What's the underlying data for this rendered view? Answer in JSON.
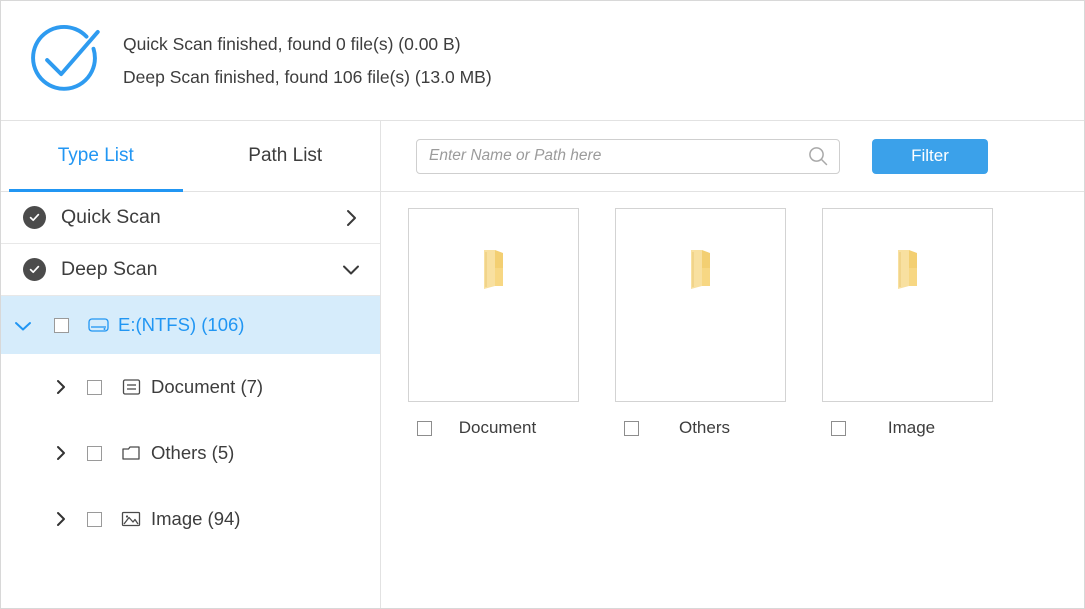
{
  "header": {
    "status_icon": "check-circle-icon",
    "lines": [
      "Quick Scan finished, found 0 file(s) (0.00  B)",
      "Deep Scan finished, found 106 file(s) (13.0 MB)"
    ]
  },
  "sidebar": {
    "tabs": [
      {
        "label": "Type List",
        "active": true
      },
      {
        "label": "Path List",
        "active": false
      }
    ],
    "scans": [
      {
        "label": "Quick Scan",
        "state_icon": "check-filled-icon",
        "chevron": "chevron-right-icon"
      },
      {
        "label": "Deep Scan",
        "state_icon": "check-filled-icon",
        "chevron": "chevron-down-icon"
      }
    ],
    "tree": [
      {
        "label": "E:(NTFS) (106)",
        "icon": "drive-icon",
        "chevron": "chevron-down-icon",
        "selected": true,
        "checked": false
      },
      {
        "label": "Document (7)",
        "icon": "document-icon",
        "chevron": "chevron-right-icon",
        "selected": false,
        "checked": false
      },
      {
        "label": "Others (5)",
        "icon": "folder-icon",
        "chevron": "chevron-right-icon",
        "selected": false,
        "checked": false
      },
      {
        "label": "Image (94)",
        "icon": "image-icon",
        "chevron": "chevron-right-icon",
        "selected": false,
        "checked": false
      }
    ]
  },
  "content": {
    "search": {
      "value": "",
      "placeholder": "Enter Name or Path here",
      "icon": "search-icon"
    },
    "filter_button": "Filter",
    "tiles": [
      {
        "label": "Document",
        "thumb_icon": "folder-thumb-icon",
        "checked": false
      },
      {
        "label": "Others",
        "thumb_icon": "folder-thumb-icon",
        "checked": false
      },
      {
        "label": "Image",
        "thumb_icon": "folder-thumb-icon",
        "checked": false
      }
    ]
  },
  "colors": {
    "accent": "#2196f3",
    "button": "#3ba1ea",
    "selection": "#d6ecfb",
    "folder": "#f5d67f",
    "text": "#3d3d3d"
  }
}
